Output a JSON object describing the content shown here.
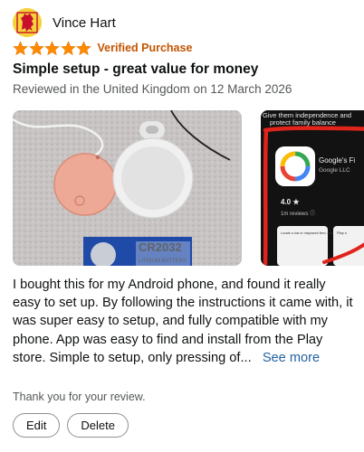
{
  "reviewer": {
    "name": "Vince Hart"
  },
  "rating": {
    "stars": 5,
    "max": 5,
    "verified_label": "Verified Purchase",
    "star_color": "#ff8a00",
    "verified_color": "#c45500"
  },
  "review": {
    "title": "Simple setup - great value for money",
    "meta": "Reviewed in the United Kingdom on 12 March 2026",
    "body": "I bought this for my Android phone, and found it really easy to set up. By following the instructions it came with, it was super easy to setup, and fully compatible with my phone. App was easy to find and install from the Play store. Simple to setup, only pressing of...",
    "see_more": "See more"
  },
  "photos": [
    {
      "battery_text": "CR2032",
      "battery_sub": "LITHIUM BATTERY"
    },
    {
      "top_text_1": "Give them independence and",
      "top_text_2": "protect family balance",
      "app_name": "Google's Fi",
      "publisher": "Google LLC",
      "rating": "4.0 ★",
      "reviews": "1m reviews ⓘ",
      "card_text": "Locate a lost or misplaced item, easily and securely",
      "card_text_2": "Play s"
    }
  ],
  "footer": {
    "thanks": "Thank you for your review.",
    "edit_label": "Edit",
    "delete_label": "Delete"
  }
}
